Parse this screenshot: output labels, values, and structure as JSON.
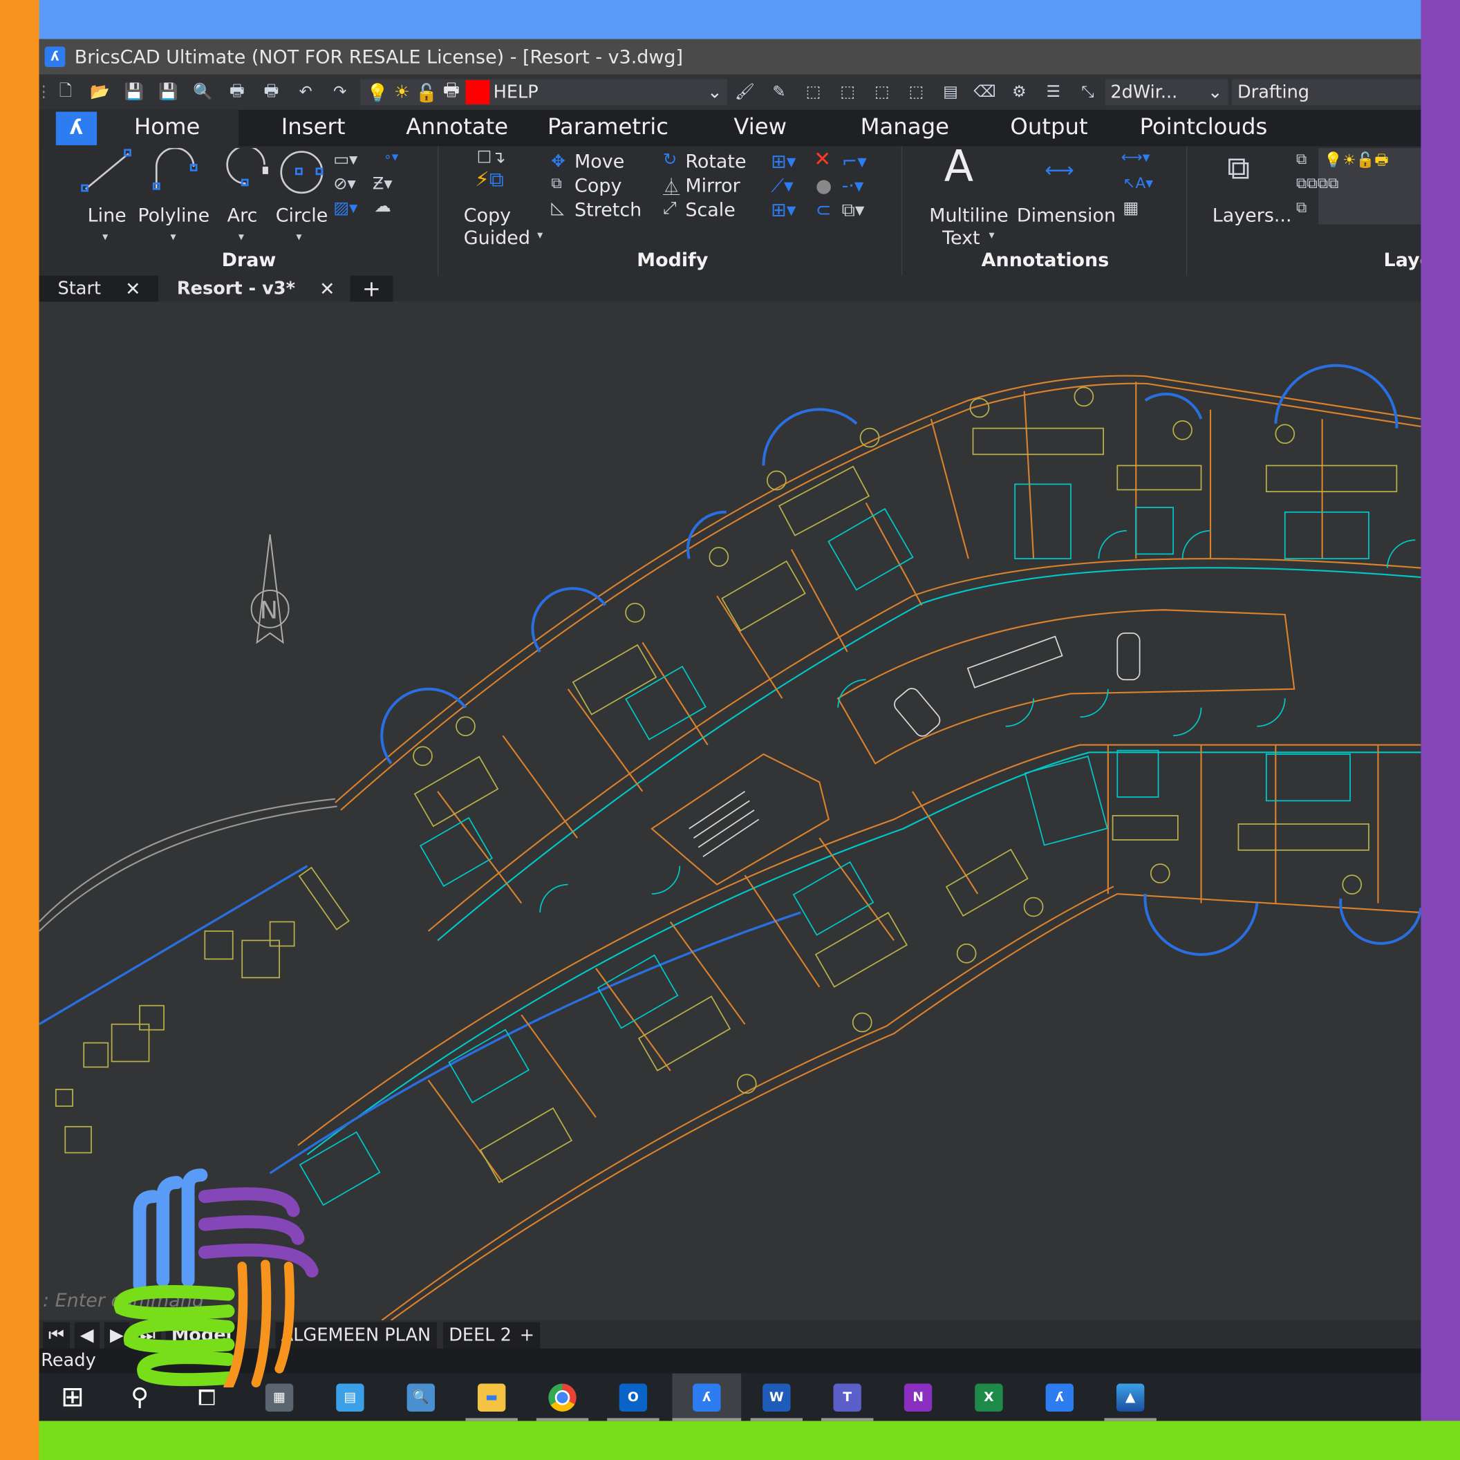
{
  "window": {
    "title": "BricsCAD Ultimate (NOT FOR RESALE License) - [Resort - v3.dwg]"
  },
  "toolbar": {
    "layer_combo": "HELP",
    "visual_style": "2dWir...",
    "workspace": "Drafting",
    "layer_color": "#ff0000"
  },
  "ribbon": {
    "tabs": [
      "Home",
      "Insert",
      "Annotate",
      "Parametric",
      "View",
      "Manage",
      "Output",
      "Pointclouds"
    ],
    "active_tab": "Home",
    "draw": {
      "label": "Draw",
      "line": "Line",
      "polyline": "Polyline",
      "arc": "Arc",
      "circle": "Circle"
    },
    "modify": {
      "label": "Modify",
      "copy_guided_1": "Copy",
      "copy_guided_2": "Guided",
      "move": "Move",
      "copy": "Copy",
      "stretch": "Stretch",
      "rotate": "Rotate",
      "mirror": "Mirror",
      "scale": "Scale"
    },
    "annotations": {
      "label": "Annotations",
      "mtext_1": "Multiline",
      "mtext_2": "Text",
      "dimension": "Dimension"
    },
    "layers": {
      "label": "Laye",
      "layers_btn": "Layers..."
    }
  },
  "doc_tabs": [
    {
      "label": "Start"
    },
    {
      "label": "Resort - v3*"
    }
  ],
  "canvas": {
    "north_label": "N",
    "command_prompt": ": Enter command"
  },
  "layout_tabs": [
    "Model",
    "ALGEMEEN PLAN",
    "DEEL 2"
  ],
  "status": {
    "text": "Ready"
  },
  "taskbar": {
    "apps": [
      "start",
      "search",
      "task-view",
      "calculator",
      "control-panel",
      "magnifier",
      "file-explorer",
      "chrome",
      "outlook",
      "bricscad",
      "word",
      "teams",
      "onenote",
      "excel",
      "bricscad-2",
      "photos"
    ]
  },
  "colors": {
    "accent": "#2d7cf0",
    "frame_left": "#f7941d",
    "frame_top": "#5b9bf8",
    "frame_right": "#8547b8",
    "frame_bottom": "#79de1a",
    "wall": "#d8812e",
    "fixture": "#00c8c8",
    "furniture": "#b8b04a",
    "glass": "#2a6fe0"
  }
}
